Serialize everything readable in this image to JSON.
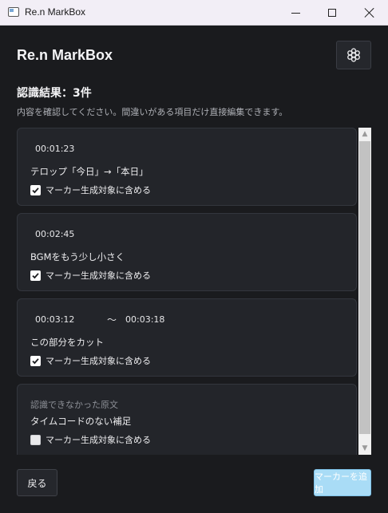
{
  "window": {
    "title": "Re.n MarkBox"
  },
  "header": {
    "app_title": "Re.n MarkBox",
    "settings_icon": "gear-icon"
  },
  "results": {
    "heading": "認識結果：3件",
    "description": "内容を確認してください。間違いがある項目だけ直接編集できます。"
  },
  "cards": [
    {
      "start": "00:01:23",
      "text": "テロップ「今日」→「本日」",
      "checkbox_label": "マーカー生成対象に含める",
      "checked": true
    },
    {
      "start": "00:02:45",
      "text": "BGMをもう少し小さく",
      "checkbox_label": "マーカー生成対象に含める",
      "checked": true
    },
    {
      "start": "00:03:12",
      "separator": "〜",
      "end": "00:03:18",
      "text": "この部分をカット",
      "checkbox_label": "マーカー生成対象に含める",
      "checked": true
    }
  ],
  "unrecognized": {
    "label": "認識できなかった原文",
    "text": "タイムコードのない補足",
    "checkbox_label": "マーカー生成対象に含める",
    "checked": false
  },
  "footer": {
    "back_label": "戻る",
    "add_label": "マーカーを追加"
  }
}
